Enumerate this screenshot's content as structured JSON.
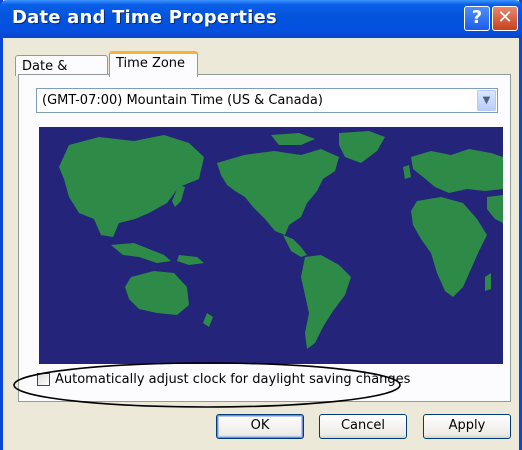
{
  "window": {
    "title": "Date and Time Properties",
    "help_label": "?",
    "close_label": "✕"
  },
  "tabs": [
    {
      "label": "Date & Time",
      "active": false
    },
    {
      "label": "Time Zone",
      "active": true
    }
  ],
  "timezone": {
    "selected": "(GMT-07:00) Mountain Time (US & Canada)",
    "dropdown_icon": "chevron-down-icon"
  },
  "map": {
    "ocean_color": "#24247a",
    "land_color": "#2e8b47"
  },
  "dst": {
    "label": "Automatically adjust clock for daylight saving changes",
    "checked": false
  },
  "buttons": {
    "ok": "OK",
    "cancel": "Cancel",
    "apply": "Apply"
  }
}
